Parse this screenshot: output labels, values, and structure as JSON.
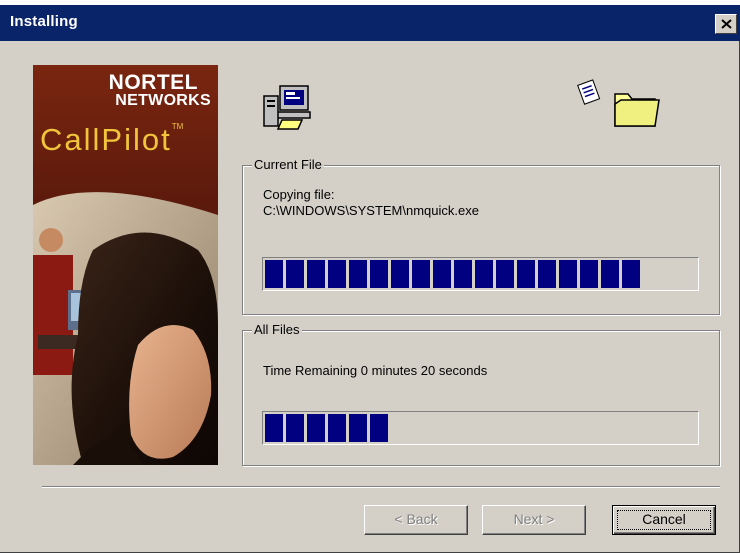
{
  "window": {
    "title": "Installing"
  },
  "banner": {
    "brand_line1": "NORTEL",
    "brand_line2": "NETWORKS",
    "product": "CallPilot",
    "trademark": "TM"
  },
  "current_file": {
    "group_label": "Current File",
    "status_label": "Copying file:",
    "file_path": "C:\\WINDOWS\\SYSTEM\\nmquick.exe",
    "progress_fraction": 0.89
  },
  "all_files": {
    "group_label": "All Files",
    "time_remaining": "Time Remaining 0 minutes 20 seconds",
    "progress_fraction": 0.3
  },
  "buttons": {
    "back_label": "< Back",
    "next_label": "Next >",
    "cancel_label": "Cancel"
  },
  "colors": {
    "titlebar": "#0a246a",
    "progress_fill": "#000080",
    "product_text": "#f1c43b"
  },
  "icons": {
    "close": "close-icon",
    "computer": "computer-icon",
    "document": "document-icon",
    "folder": "folder-icon"
  }
}
